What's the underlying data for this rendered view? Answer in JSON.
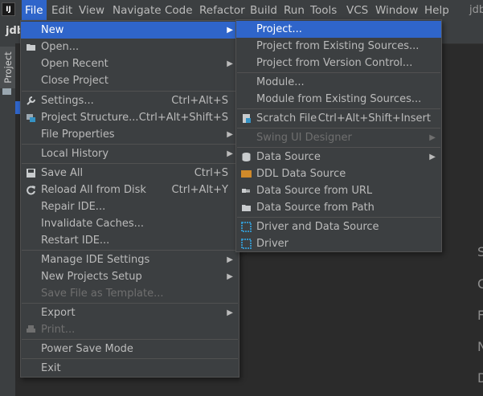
{
  "menubar": {
    "items": [
      "File",
      "Edit",
      "View",
      "Navigate",
      "Code",
      "Refactor",
      "Build",
      "Run",
      "Tools",
      "VCS",
      "Window",
      "Help"
    ],
    "title": "jdb",
    "active_color": "#2f65ca"
  },
  "background": {
    "project_tab": "Project",
    "project_header": "jdb",
    "editor_clipped": [
      "S",
      "C",
      "F",
      "N",
      "D"
    ]
  },
  "file_menu": {
    "items": [
      {
        "label": "New",
        "shortcut": "",
        "submenu": true
      },
      {
        "label": "Open...",
        "shortcut": "",
        "icon": "folder-open-icon"
      },
      {
        "label": "Open Recent",
        "shortcut": "",
        "submenu": true
      },
      {
        "label": "Close Project",
        "shortcut": ""
      },
      {
        "label": "Settings...",
        "shortcut": "Ctrl+Alt+S",
        "icon": "wrench-icon"
      },
      {
        "label": "Project Structure...",
        "shortcut": "Ctrl+Alt+Shift+S",
        "icon": "project-structure-icon"
      },
      {
        "label": "File Properties",
        "shortcut": "",
        "submenu": true
      },
      {
        "label": "Local History",
        "shortcut": "",
        "submenu": true
      },
      {
        "label": "Save All",
        "shortcut": "Ctrl+S",
        "icon": "save-icon"
      },
      {
        "label": "Reload All from Disk",
        "shortcut": "Ctrl+Alt+Y",
        "icon": "reload-icon"
      },
      {
        "label": "Repair IDE...",
        "shortcut": ""
      },
      {
        "label": "Invalidate Caches...",
        "shortcut": ""
      },
      {
        "label": "Restart IDE...",
        "shortcut": ""
      },
      {
        "label": "Manage IDE Settings",
        "shortcut": "",
        "submenu": true
      },
      {
        "label": "New Projects Setup",
        "shortcut": "",
        "submenu": true
      },
      {
        "label": "Save File as Template...",
        "shortcut": "",
        "disabled": true
      },
      {
        "label": "Export",
        "shortcut": "",
        "submenu": true
      },
      {
        "label": "Print...",
        "shortcut": "",
        "disabled": true,
        "icon": "print-icon"
      },
      {
        "label": "Power Save Mode",
        "shortcut": ""
      },
      {
        "label": "Exit",
        "shortcut": ""
      }
    ]
  },
  "new_menu": {
    "items": [
      {
        "label": "Project..."
      },
      {
        "label": "Project from Existing Sources..."
      },
      {
        "label": "Project from Version Control..."
      },
      {
        "label": "Module..."
      },
      {
        "label": "Module from Existing Sources..."
      },
      {
        "label": "Scratch File",
        "shortcut": "Ctrl+Alt+Shift+Insert",
        "icon": "scratch-file-icon"
      },
      {
        "label": "Swing UI Designer",
        "disabled": true,
        "submenu": true
      },
      {
        "label": "Data Source",
        "submenu": true,
        "icon": "database-icon"
      },
      {
        "label": "DDL Data Source",
        "icon": "ddl-icon"
      },
      {
        "label": "Data Source from URL",
        "icon": "plug-icon"
      },
      {
        "label": "Data Source from Path",
        "icon": "folder-icon"
      },
      {
        "label": "Driver and Data Source",
        "icon": "driver-icon"
      },
      {
        "label": "Driver",
        "icon": "driver-icon"
      }
    ]
  }
}
